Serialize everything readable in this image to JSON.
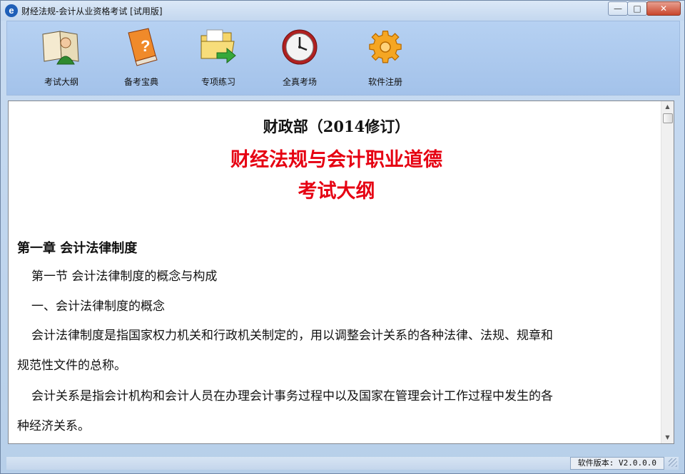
{
  "window": {
    "title": "财经法规-会计从业资格考试 [试用版]",
    "app_icon_letter": "e"
  },
  "titlebar_buttons": {
    "minimize": "—",
    "maximize": "□",
    "close": "✕"
  },
  "toolbar": {
    "items": [
      {
        "label": "考试大纲",
        "icon": "book-person-icon"
      },
      {
        "label": "备考宝典",
        "icon": "question-book-icon"
      },
      {
        "label": "专项练习",
        "icon": "folder-arrow-icon"
      },
      {
        "label": "全真考场",
        "icon": "clock-icon"
      },
      {
        "label": "软件注册",
        "icon": "gear-icon"
      }
    ]
  },
  "document": {
    "heading1": "财政部（2014修订）",
    "heading2": "财经法规与会计职业道德",
    "heading3": "考试大纲",
    "chapter": "第一章  会计法律制度",
    "section": "第一节  会计法律制度的概念与构成",
    "subsection": "一、会计法律制度的概念",
    "para1_line1": "会计法律制度是指国家权力机关和行政机关制定的，用以调整会计关系的各种法律、法规、规章和",
    "para1_line2": "规范性文件的总称。",
    "para2_line1": "会计关系是指会计机构和会计人员在办理会计事务过程中以及国家在管理会计工作过程中发生的各",
    "para2_line2": "种经济关系。"
  },
  "status": {
    "version": "软件版本: V2.0.0.0"
  },
  "colors": {
    "accent_red": "#e60012",
    "toolbar_blue": "#a3c2ea"
  }
}
